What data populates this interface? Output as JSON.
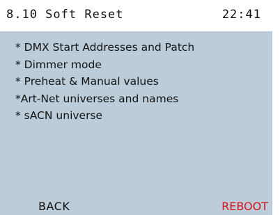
{
  "header": {
    "title": "8.10 Soft Reset",
    "time": "22:41"
  },
  "reset_items": [
    "* DMX Start Addresses and Patch",
    "* Dimmer mode",
    "* Preheat & Manual values",
    "*Art-Net universes and names",
    "* sACN universe"
  ],
  "footer": {
    "back_label": "BACK",
    "reboot_label": "REBOOT"
  },
  "colors": {
    "screen_background": "#bccdd9",
    "titlebar_background": "#ffffff",
    "text": "#111111",
    "reboot_text": "#d4141e"
  }
}
